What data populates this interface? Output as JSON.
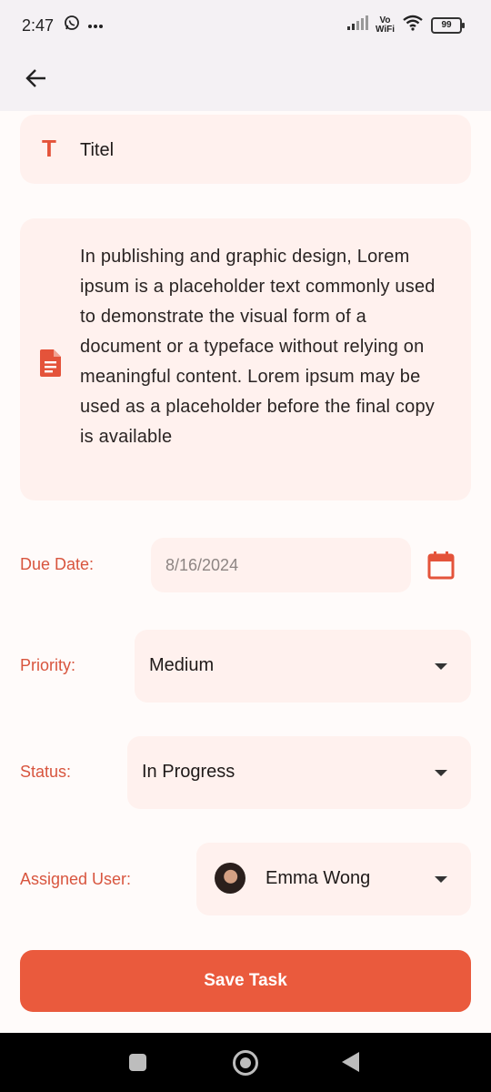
{
  "status_bar": {
    "time": "2:47",
    "network_label_top": "Vo",
    "network_label_bottom": "WiFi",
    "battery": "99"
  },
  "app_bar": {
    "back_icon": "arrow-left-icon"
  },
  "form": {
    "title_value": "Titel",
    "description_value": "In publishing and graphic design, Lorem ipsum is a placeholder text commonly used to demonstrate the visual form of a document or a typeface without relying on meaningful content. Lorem ipsum may be used as a placeholder before the final copy is available",
    "due_date_label": "Due Date:",
    "due_date_value": "8/16/2024",
    "priority_label": "Priority:",
    "priority_value": "Medium",
    "status_label": "Status:",
    "status_value": "In Progress",
    "assigned_user_label": "Assigned User:",
    "assigned_user_value": "Emma Wong",
    "save_button_label": "Save Task"
  },
  "colors": {
    "accent": "#ea5a3d",
    "label": "#d8553e",
    "field_bg": "#fff1ee"
  }
}
